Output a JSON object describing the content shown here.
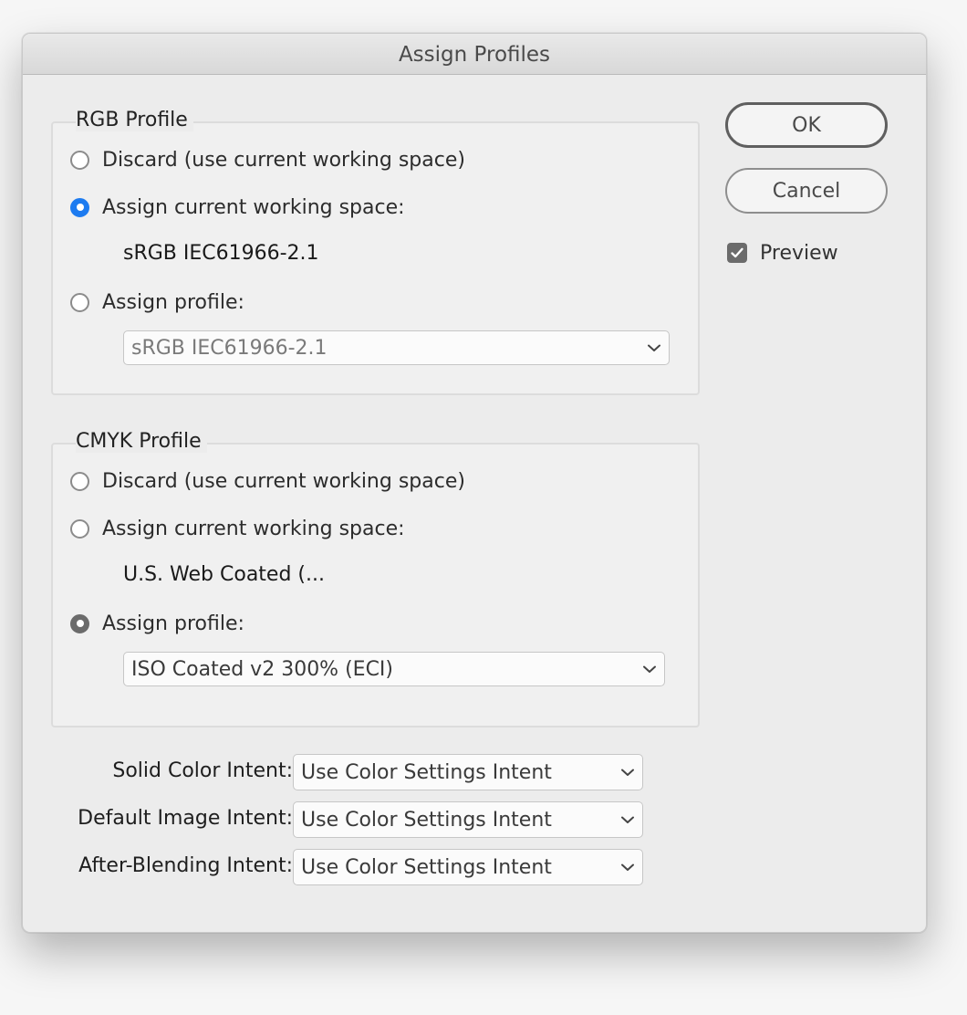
{
  "window": {
    "title": "Assign Profiles"
  },
  "buttons": {
    "ok": "OK",
    "cancel": "Cancel"
  },
  "preview": {
    "label": "Preview",
    "checked": true
  },
  "rgb": {
    "group_label": "RGB Profile",
    "discard_label": "Discard (use current working space)",
    "assign_current_label": "Assign current working space:",
    "current_space": "sRGB IEC61966-2.1",
    "assign_profile_label": "Assign profile:",
    "profile_select": "sRGB IEC61966-2.1",
    "selected": "assign_current"
  },
  "cmyk": {
    "group_label": "CMYK Profile",
    "discard_label": "Discard (use current working space)",
    "assign_current_label": "Assign current working space:",
    "current_space": "U.S. Web Coated (...",
    "assign_profile_label": "Assign profile:",
    "profile_select": "ISO Coated v2 300% (ECI)",
    "selected": "assign_profile"
  },
  "intents": [
    {
      "label": "Solid Color Intent:",
      "value": "Use Color Settings Intent"
    },
    {
      "label": "Default Image Intent:",
      "value": "Use Color Settings Intent"
    },
    {
      "label": "After-Blending Intent:",
      "value": "Use Color Settings Intent"
    }
  ],
  "colors": {
    "accent": "#1d7bf0",
    "checked_gray": "#6b6b6b"
  },
  "icons": {
    "chevron": "chevron-down-icon",
    "check": "checkmark-icon"
  }
}
